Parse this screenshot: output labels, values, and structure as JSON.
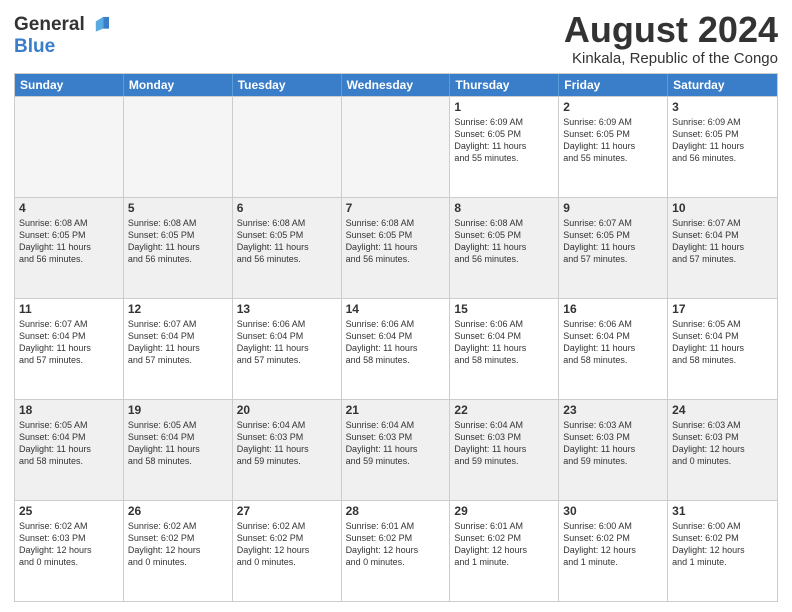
{
  "header": {
    "logo_line1": "General",
    "logo_line2": "Blue",
    "month_year": "August 2024",
    "location": "Kinkala, Republic of the Congo"
  },
  "weekdays": [
    "Sunday",
    "Monday",
    "Tuesday",
    "Wednesday",
    "Thursday",
    "Friday",
    "Saturday"
  ],
  "rows": [
    [
      {
        "day": "",
        "text": "",
        "empty": true
      },
      {
        "day": "",
        "text": "",
        "empty": true
      },
      {
        "day": "",
        "text": "",
        "empty": true
      },
      {
        "day": "",
        "text": "",
        "empty": true
      },
      {
        "day": "1",
        "text": "Sunrise: 6:09 AM\nSunset: 6:05 PM\nDaylight: 11 hours\nand 55 minutes."
      },
      {
        "day": "2",
        "text": "Sunrise: 6:09 AM\nSunset: 6:05 PM\nDaylight: 11 hours\nand 55 minutes."
      },
      {
        "day": "3",
        "text": "Sunrise: 6:09 AM\nSunset: 6:05 PM\nDaylight: 11 hours\nand 56 minutes."
      }
    ],
    [
      {
        "day": "4",
        "text": "Sunrise: 6:08 AM\nSunset: 6:05 PM\nDaylight: 11 hours\nand 56 minutes."
      },
      {
        "day": "5",
        "text": "Sunrise: 6:08 AM\nSunset: 6:05 PM\nDaylight: 11 hours\nand 56 minutes."
      },
      {
        "day": "6",
        "text": "Sunrise: 6:08 AM\nSunset: 6:05 PM\nDaylight: 11 hours\nand 56 minutes."
      },
      {
        "day": "7",
        "text": "Sunrise: 6:08 AM\nSunset: 6:05 PM\nDaylight: 11 hours\nand 56 minutes."
      },
      {
        "day": "8",
        "text": "Sunrise: 6:08 AM\nSunset: 6:05 PM\nDaylight: 11 hours\nand 56 minutes."
      },
      {
        "day": "9",
        "text": "Sunrise: 6:07 AM\nSunset: 6:05 PM\nDaylight: 11 hours\nand 57 minutes."
      },
      {
        "day": "10",
        "text": "Sunrise: 6:07 AM\nSunset: 6:04 PM\nDaylight: 11 hours\nand 57 minutes."
      }
    ],
    [
      {
        "day": "11",
        "text": "Sunrise: 6:07 AM\nSunset: 6:04 PM\nDaylight: 11 hours\nand 57 minutes."
      },
      {
        "day": "12",
        "text": "Sunrise: 6:07 AM\nSunset: 6:04 PM\nDaylight: 11 hours\nand 57 minutes."
      },
      {
        "day": "13",
        "text": "Sunrise: 6:06 AM\nSunset: 6:04 PM\nDaylight: 11 hours\nand 57 minutes."
      },
      {
        "day": "14",
        "text": "Sunrise: 6:06 AM\nSunset: 6:04 PM\nDaylight: 11 hours\nand 58 minutes."
      },
      {
        "day": "15",
        "text": "Sunrise: 6:06 AM\nSunset: 6:04 PM\nDaylight: 11 hours\nand 58 minutes."
      },
      {
        "day": "16",
        "text": "Sunrise: 6:06 AM\nSunset: 6:04 PM\nDaylight: 11 hours\nand 58 minutes."
      },
      {
        "day": "17",
        "text": "Sunrise: 6:05 AM\nSunset: 6:04 PM\nDaylight: 11 hours\nand 58 minutes."
      }
    ],
    [
      {
        "day": "18",
        "text": "Sunrise: 6:05 AM\nSunset: 6:04 PM\nDaylight: 11 hours\nand 58 minutes."
      },
      {
        "day": "19",
        "text": "Sunrise: 6:05 AM\nSunset: 6:04 PM\nDaylight: 11 hours\nand 58 minutes."
      },
      {
        "day": "20",
        "text": "Sunrise: 6:04 AM\nSunset: 6:03 PM\nDaylight: 11 hours\nand 59 minutes."
      },
      {
        "day": "21",
        "text": "Sunrise: 6:04 AM\nSunset: 6:03 PM\nDaylight: 11 hours\nand 59 minutes."
      },
      {
        "day": "22",
        "text": "Sunrise: 6:04 AM\nSunset: 6:03 PM\nDaylight: 11 hours\nand 59 minutes."
      },
      {
        "day": "23",
        "text": "Sunrise: 6:03 AM\nSunset: 6:03 PM\nDaylight: 11 hours\nand 59 minutes."
      },
      {
        "day": "24",
        "text": "Sunrise: 6:03 AM\nSunset: 6:03 PM\nDaylight: 12 hours\nand 0 minutes."
      }
    ],
    [
      {
        "day": "25",
        "text": "Sunrise: 6:02 AM\nSunset: 6:03 PM\nDaylight: 12 hours\nand 0 minutes."
      },
      {
        "day": "26",
        "text": "Sunrise: 6:02 AM\nSunset: 6:02 PM\nDaylight: 12 hours\nand 0 minutes."
      },
      {
        "day": "27",
        "text": "Sunrise: 6:02 AM\nSunset: 6:02 PM\nDaylight: 12 hours\nand 0 minutes."
      },
      {
        "day": "28",
        "text": "Sunrise: 6:01 AM\nSunset: 6:02 PM\nDaylight: 12 hours\nand 0 minutes."
      },
      {
        "day": "29",
        "text": "Sunrise: 6:01 AM\nSunset: 6:02 PM\nDaylight: 12 hours\nand 1 minute."
      },
      {
        "day": "30",
        "text": "Sunrise: 6:00 AM\nSunset: 6:02 PM\nDaylight: 12 hours\nand 1 minute."
      },
      {
        "day": "31",
        "text": "Sunrise: 6:00 AM\nSunset: 6:02 PM\nDaylight: 12 hours\nand 1 minute."
      }
    ]
  ]
}
